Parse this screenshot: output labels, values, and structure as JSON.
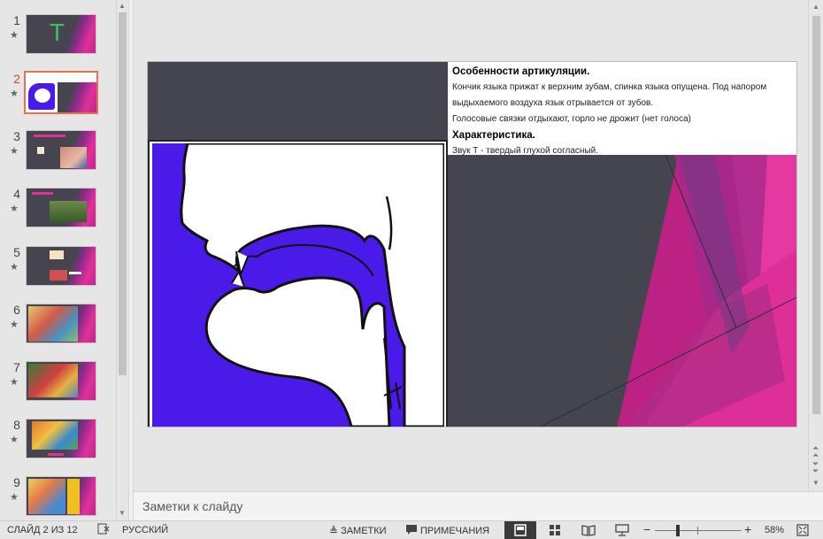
{
  "thumbnails": [
    {
      "number": "1",
      "star": "★",
      "selected": false
    },
    {
      "number": "2",
      "star": "★",
      "selected": true
    },
    {
      "number": "3",
      "star": "★",
      "selected": false
    },
    {
      "number": "4",
      "star": "★",
      "selected": false
    },
    {
      "number": "5",
      "star": "★",
      "selected": false
    },
    {
      "number": "6",
      "star": "★",
      "selected": false
    },
    {
      "number": "7",
      "star": "★",
      "selected": false
    },
    {
      "number": "8",
      "star": "★",
      "selected": false
    },
    {
      "number": "9",
      "star": "★",
      "selected": false
    }
  ],
  "thumb1_letter": "T",
  "slide": {
    "heading1": "Особенности артикуляции.",
    "para1": "Кончик  языка прижат к верхним зубам, спинка языка опущена. Под напором выдыхаемого воздуха язык отрывается от зубов.",
    "para2": "Голосовые связки отдыхают, горло не дрожит (нет голоса)",
    "heading2": "Характеристика.",
    "para3": "Звук Т - твердый глухой согласный."
  },
  "notes_placeholder": "Заметки к слайду",
  "status": {
    "slide_counter": "СЛАЙД 2 ИЗ 12",
    "language": "РУССКИЙ",
    "notes_button": "ЗАМЕТКИ",
    "comments_button": "ПРИМЕЧАНИЯ",
    "zoom_minus": "−",
    "zoom_plus": "+",
    "zoom_level": "58%",
    "zoom_fraction": 0.58
  },
  "colors": {
    "accent_selected": "#e8704a",
    "slide_bg": "#45454f",
    "magenta": "#e0309a",
    "diagram_blue": "#4a1ae8"
  }
}
